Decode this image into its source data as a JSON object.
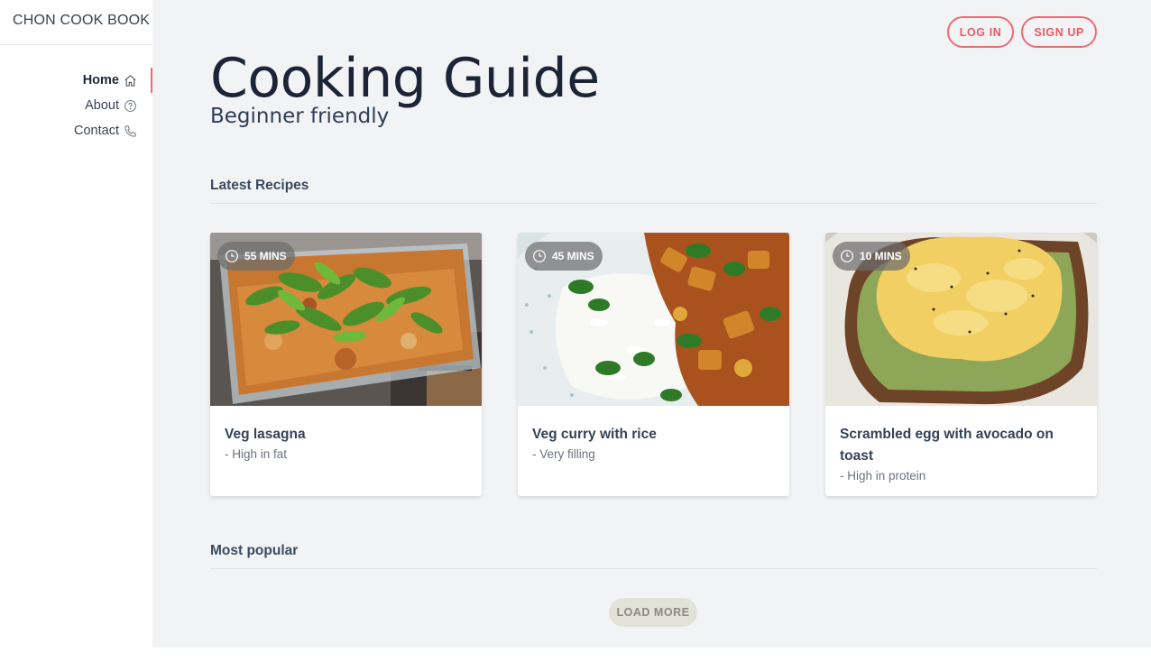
{
  "sidebar": {
    "brand": "CHON COOK BOOK",
    "items": [
      {
        "label": "Home",
        "icon": "home-icon",
        "active": true
      },
      {
        "label": "About",
        "icon": "help-circle-icon",
        "active": false
      },
      {
        "label": "Contact",
        "icon": "phone-icon",
        "active": false
      }
    ]
  },
  "header": {
    "login_label": "LOG IN",
    "signup_label": "SIGN UP",
    "title": "Cooking Guide",
    "subtitle": "Beginner friendly"
  },
  "sections": {
    "latest": "Latest Recipes",
    "popular": "Most popular"
  },
  "recipes": [
    {
      "time": "55 MINS",
      "title": "Veg lasagna",
      "desc": "- High in fat"
    },
    {
      "time": "45 MINS",
      "title": "Veg curry with rice",
      "desc": "- Very filling"
    },
    {
      "time": "10 MINS",
      "title": "Scrambled egg with avocado on toast",
      "desc": "- High in protein"
    }
  ],
  "load_more_label": "LOAD MORE",
  "colors": {
    "accent": "#ef6b73",
    "main_bg": "#f2f3f5",
    "title": "#1c2537"
  }
}
